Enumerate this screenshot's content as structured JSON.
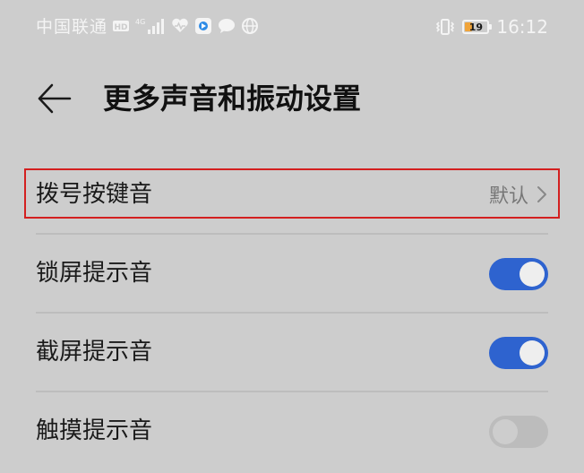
{
  "status_bar": {
    "carrier": "中国联通",
    "icons": [
      "hd-icon",
      "4g-signal-icon",
      "health-icon",
      "app-icon",
      "chat-icon",
      "globe-icon"
    ],
    "network_label": "4G",
    "vibrate_icon": "vibrate-icon",
    "battery_level": "19",
    "time": "16:12"
  },
  "header": {
    "title": "更多声音和振动设置",
    "back_icon": "back-arrow-icon"
  },
  "settings": [
    {
      "label": "拨号按键音",
      "value": "默认",
      "type": "link"
    },
    {
      "label": "锁屏提示音",
      "type": "toggle",
      "enabled": true
    },
    {
      "label": "截屏提示音",
      "type": "toggle",
      "enabled": true
    },
    {
      "label": "触摸提示音",
      "type": "toggle",
      "enabled": false
    }
  ],
  "colors": {
    "background": "#cdcdcd",
    "toggle_on": "#2e63cf",
    "toggle_off": "#bcbcbc",
    "highlight_border": "#d32020"
  }
}
